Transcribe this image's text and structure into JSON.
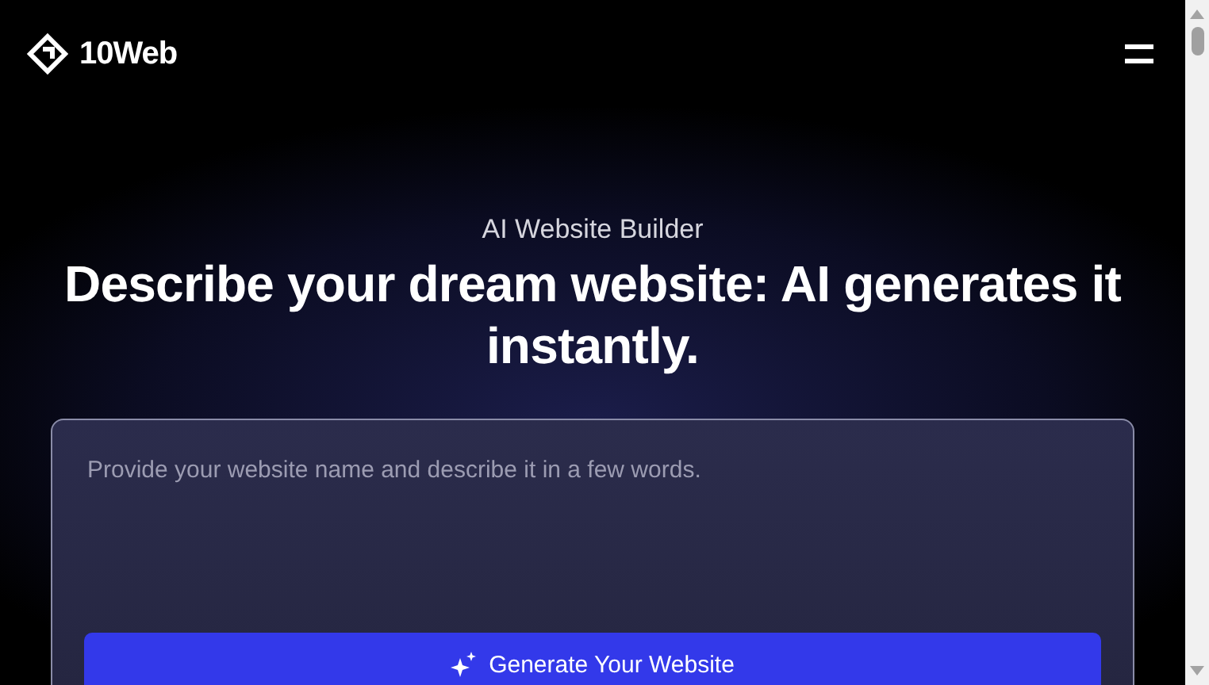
{
  "header": {
    "brand": "10Web"
  },
  "hero": {
    "eyebrow": "AI Website Builder",
    "heading": "Describe your dream website: AI generates it instantly."
  },
  "prompt_card": {
    "placeholder": "Provide your website name and describe it in a few words.",
    "button": "Generate Your Website"
  }
}
